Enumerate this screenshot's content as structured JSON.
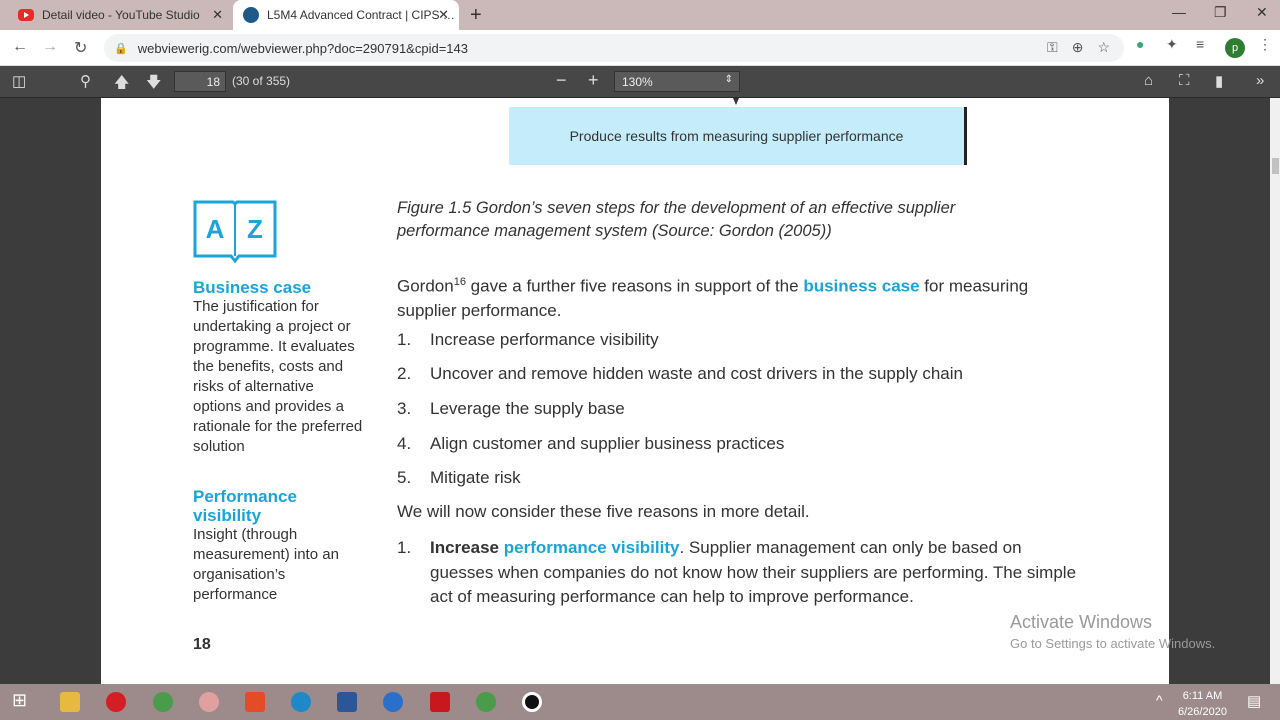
{
  "browser": {
    "tabs": [
      {
        "title": "Detail video - YouTube Studio",
        "icon": "youtube-icon",
        "active": false
      },
      {
        "title": "L5M4 Advanced Contract | CIPS …",
        "icon": "webviewer-icon",
        "active": true
      }
    ],
    "url": "webviewerig.com/webviewer.php?doc=290791&cpid=143",
    "profile_initial": "p"
  },
  "pdf_toolbar": {
    "page_input": "18",
    "page_count": "(30 of 355)",
    "zoom_minus": "−",
    "zoom_plus": "+",
    "zoom_level": "130%"
  },
  "document": {
    "flow_box": "Produce results from measuring supplier performance",
    "az_letters": [
      "A",
      "Z"
    ],
    "glossary": [
      {
        "term": "Business case",
        "definition": "The justification for undertaking a project or programme. It evaluates the benefits, costs and risks of alternative options and provides a rationale for the preferred solution"
      },
      {
        "term": "Performance visibility",
        "definition": "Insight (through measurement) into an organisation’s performance"
      }
    ],
    "figure_caption": "Figure 1.5 Gordon’s seven steps for the development of an effective supplier performance management system (Source: Gordon (2005))",
    "intro": {
      "before": "Gordon",
      "superscript": "16",
      "middle": " gave a further five reasons in support of the ",
      "highlight": "business case",
      "after": " for measuring supplier performance."
    },
    "reasons": [
      {
        "num": "1.",
        "text": "Increase performance visibility"
      },
      {
        "num": "2.",
        "text": "Uncover and remove hidden waste and cost drivers in the supply chain"
      },
      {
        "num": "3.",
        "text": "Leverage the supply base"
      },
      {
        "num": "4.",
        "text": "Align customer and supplier business practices"
      },
      {
        "num": "5.",
        "text": "Mitigate risk"
      }
    ],
    "detail_intro": "We will now consider these five reasons in more detail.",
    "detail_1": {
      "num": "1.",
      "bold": "Increase ",
      "highlight": "performance visibility",
      "rest": ". Supplier management can only be based on guesses when companies do not know how their suppliers are performing. The simple act of measuring performance can help to improve performance."
    },
    "page_number": "18"
  },
  "watermark": {
    "title": "Activate Windows",
    "subtitle": "Go to Settings to activate Windows."
  },
  "taskbar": {
    "time": "6:11 AM",
    "date": "6/26/2020"
  }
}
